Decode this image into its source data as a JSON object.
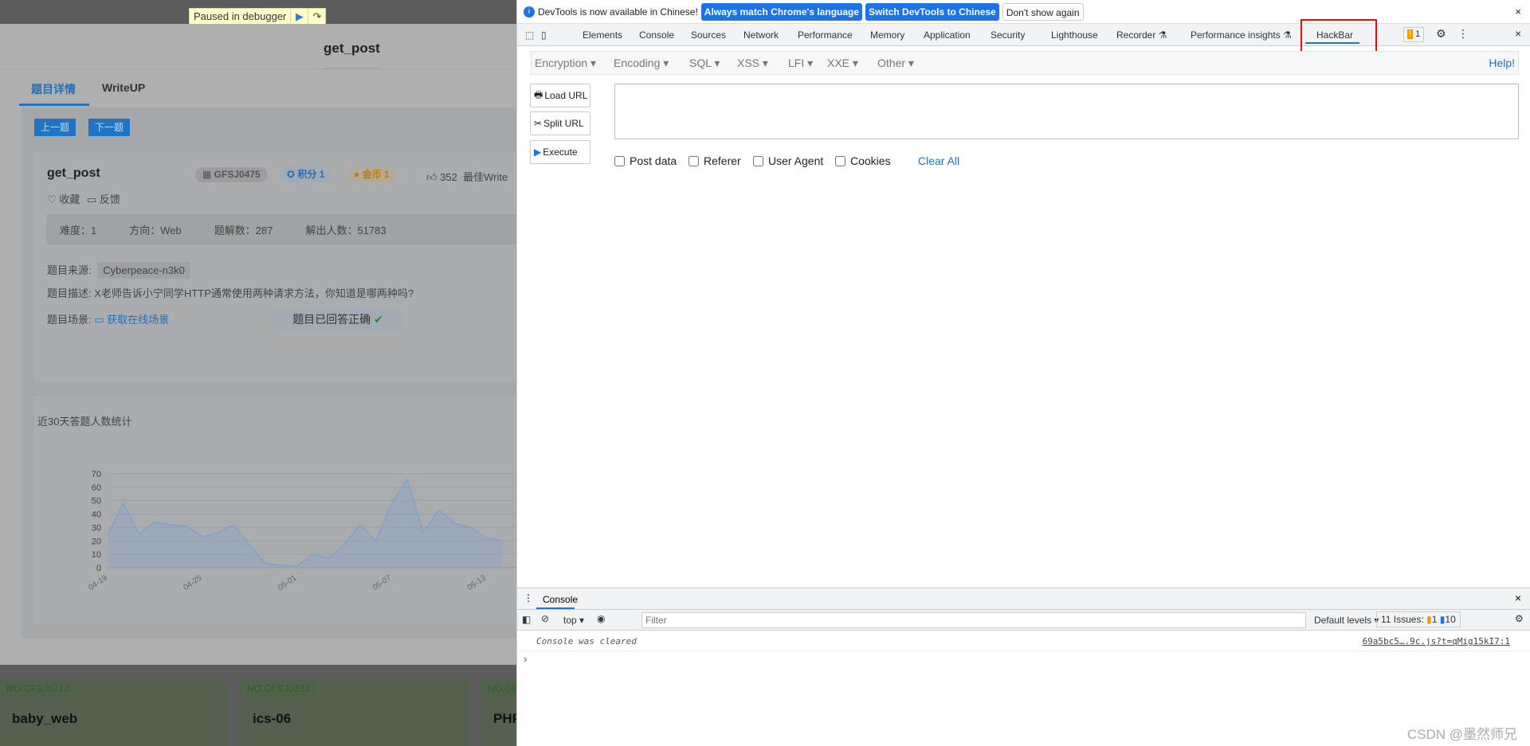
{
  "debugger": {
    "paused_label": "Paused in debugger"
  },
  "modal": {
    "title": "get_post",
    "tabs": [
      "题目详情",
      "WriteUP"
    ],
    "prev": "上一题",
    "next": "下一题",
    "challenge": {
      "name": "get_post",
      "id": "GFSJ0475",
      "score": "积分 1",
      "coins": "金币 1",
      "likes": "352",
      "best_writeup": "最佳Write",
      "favorite": "收藏",
      "feedback": "反馈",
      "stats": [
        "难度：1",
        "方向：Web",
        "题解数：287",
        "解出人数：51783"
      ],
      "source_label": "题目来源:",
      "source": "Cyberpeace-n3k0",
      "desc_label": "题目描述:",
      "desc": "X老师告诉小宁同学HTTP通常使用两种请求方法，你知道是哪两种吗?",
      "scene_label": "题目场景:",
      "scene_link": "获取在线场景",
      "answered": "题目已回答正确"
    }
  },
  "chart_data": {
    "type": "area",
    "title": "近30天答题人数统计",
    "ylim": [
      0,
      70
    ],
    "yticks": [
      0,
      10,
      20,
      30,
      40,
      50,
      60,
      70
    ],
    "xtick_labels": [
      "04-19",
      "04-25",
      "05-01",
      "05-07",
      "05-13"
    ],
    "x": [
      "04-19",
      "04-20",
      "04-21",
      "04-22",
      "04-23",
      "04-24",
      "04-25",
      "04-26",
      "04-27",
      "04-28",
      "04-29",
      "04-30",
      "05-01",
      "05-02",
      "05-03",
      "05-04",
      "05-05",
      "05-06",
      "05-07",
      "05-08",
      "05-09",
      "05-10",
      "05-11",
      "05-12",
      "05-13",
      "05-14"
    ],
    "values": [
      24,
      48,
      25,
      34,
      32,
      31,
      23,
      26,
      32,
      17,
      3,
      2,
      1,
      10,
      7,
      17,
      32,
      20,
      48,
      66,
      26,
      43,
      33,
      30,
      22,
      20
    ],
    "color": "#7ea3cc",
    "grid": true
  },
  "bg_cards": [
    {
      "id": "NO.GFSJ0712",
      "name": "baby_web"
    },
    {
      "id": "NO.GFSJ0333",
      "name": "ics-06"
    },
    {
      "id": "NO.GF",
      "name": "PHP"
    }
  ],
  "devtools": {
    "info": "DevTools is now available in Chinese!",
    "btn_match": "Always match Chrome's language",
    "btn_switch": "Switch DevTools to Chinese",
    "btn_dont": "Don't show again",
    "tabs": [
      "Elements",
      "Console",
      "Sources",
      "Network",
      "Performance",
      "Memory",
      "Application",
      "Security",
      "Lighthouse",
      "Recorder",
      "Performance insights",
      "HackBar"
    ],
    "active_tab": "HackBar",
    "issues_badge": "1",
    "highlight_color": "#ff0000"
  },
  "hackbar": {
    "menus": [
      "Encryption",
      "Encoding",
      "SQL",
      "XSS",
      "LFI",
      "XXE",
      "Other"
    ],
    "help": "Help!",
    "load": "Load URL",
    "split": "Split URL",
    "execute": "Execute",
    "url": "",
    "checks": [
      "Post data",
      "Referer",
      "User Agent",
      "Cookies"
    ],
    "clear": "Clear All"
  },
  "console": {
    "tab": "Console",
    "context": "top",
    "filter_placeholder": "Filter",
    "levels": "Default levels",
    "issues": "11 Issues:",
    "warn": "1",
    "info": "10",
    "message": "Console was cleared",
    "source": "69a5bc5….9c.js?t=qMig15kI7:1"
  },
  "watermark": "CSDN @墨然师兄"
}
